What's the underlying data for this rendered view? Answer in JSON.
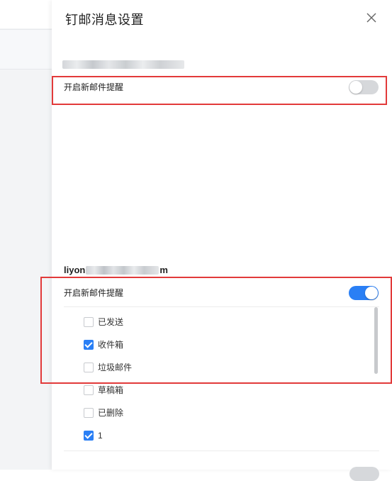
{
  "panel": {
    "title": "钉邮消息设置",
    "close_icon": "close-icon"
  },
  "accounts": [
    {
      "address_prefix": "",
      "address_suffix": "",
      "new_mail_alert_label": "开启新邮件提醒",
      "new_mail_alert_enabled": false
    },
    {
      "address_prefix": "liyon",
      "address_suffix": "m",
      "new_mail_alert_label": "开启新邮件提醒",
      "new_mail_alert_enabled": true,
      "folders": [
        {
          "label": "已发送",
          "checked": false
        },
        {
          "label": "收件箱",
          "checked": true
        },
        {
          "label": "垃圾邮件",
          "checked": false
        },
        {
          "label": "草稿箱",
          "checked": false
        },
        {
          "label": "已删除",
          "checked": false
        },
        {
          "label": "1",
          "checked": true
        }
      ]
    }
  ],
  "colors": {
    "accent": "#2a7ff5",
    "highlight": "#e23a3a",
    "toggle_off": "#d6d8db"
  }
}
